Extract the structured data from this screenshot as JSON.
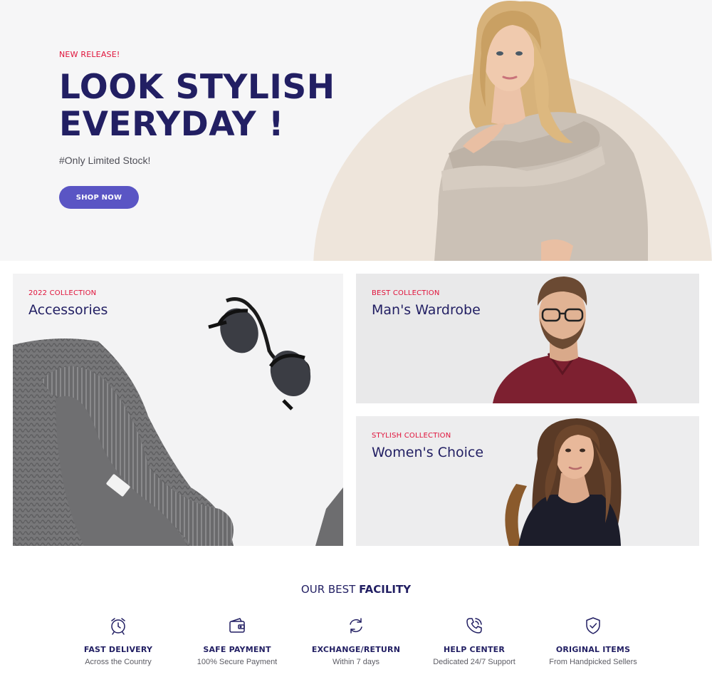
{
  "hero": {
    "eyebrow": "NEW RELEASE!",
    "title_line1": "LOOK STYLISH",
    "title_line2": "EVERYDAY !",
    "subtitle": "#Only Limited Stock!",
    "cta_label": "SHOP NOW"
  },
  "collections": [
    {
      "eyebrow": "2022 COLLECTION",
      "title": "Accessories"
    },
    {
      "eyebrow": "BEST COLLECTION",
      "title": "Man's Wardrobe"
    },
    {
      "eyebrow": "STYLISH COLLECTION",
      "title": "Women's Choice"
    }
  ],
  "facility": {
    "title_regular": "OUR BEST ",
    "title_bold": "FACILITY",
    "items": [
      {
        "icon": "alarm-clock-icon",
        "name": "FAST DELIVERY",
        "desc": "Across the Country"
      },
      {
        "icon": "wallet-icon",
        "name": "SAFE PAYMENT",
        "desc": "100% Secure Payment"
      },
      {
        "icon": "refresh-icon",
        "name": "EXCHANGE/RETURN",
        "desc": "Within 7 days"
      },
      {
        "icon": "phone-call-icon",
        "name": "HELP CENTER",
        "desc": "Dedicated 24/7 Support"
      },
      {
        "icon": "shield-check-icon",
        "name": "ORIGINAL ITEMS",
        "desc": "From Handpicked Sellers"
      }
    ]
  },
  "colors": {
    "brand_navy": "#221f63",
    "accent_red": "#e0123a",
    "button_purple": "#5a55c4",
    "hero_arc": "#eee5db"
  }
}
